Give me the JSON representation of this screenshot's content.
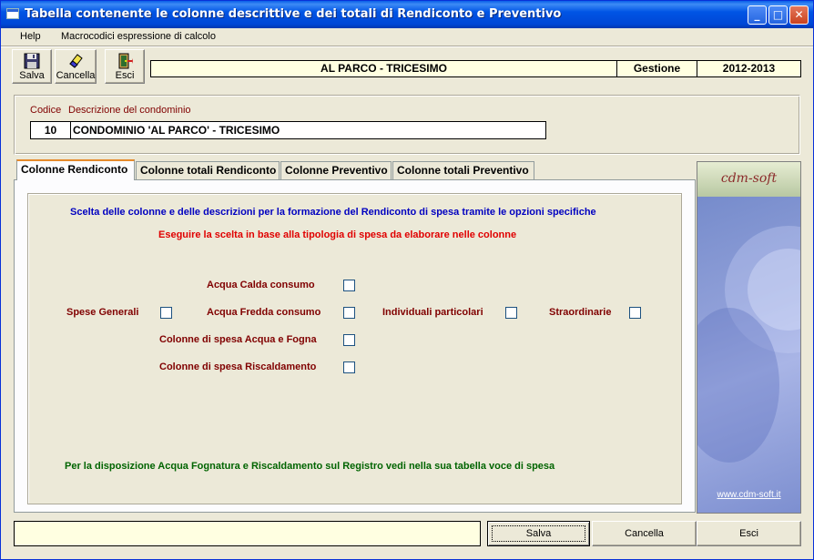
{
  "window": {
    "title": "Tabella contenente le colonne descrittive e dei totali di Rendiconto e Preventivo",
    "minimize_glyph": "_",
    "maximize_glyph": "□",
    "close_glyph": "✕"
  },
  "menubar": {
    "items": [
      "Help",
      "Macrocodici espressione di calcolo"
    ]
  },
  "toolbar": {
    "save_label": "Salva",
    "delete_label": "Cancella",
    "exit_label": "Esci",
    "condominium_name": "AL PARCO - TRICESIMO",
    "management_label": "Gestione",
    "management_period": "2012-2013"
  },
  "condominium": {
    "code_label": "Codice",
    "description_label": "Descrizione del condominio",
    "code_value": "10",
    "description_value": "CONDOMINIO 'AL PARCO' - TRICESIMO"
  },
  "tabs": [
    {
      "label": "Colonne Rendiconto",
      "active": true
    },
    {
      "label": "Colonne totali Rendiconto",
      "active": false
    },
    {
      "label": "Colonne Preventivo",
      "active": false
    },
    {
      "label": "Colonne totali Preventivo",
      "active": false
    }
  ],
  "content": {
    "heading": "Scelta delle colonne e delle descrizioni per la formazione del Rendiconto di spesa tramite le opzioni specifiche",
    "subheading": "Eseguire la scelta in base alla tipologia di spesa da elaborare nelle colonne",
    "options": {
      "acqua_calda": "Acqua Calda consumo",
      "spese_generali": "Spese Generali",
      "acqua_fredda": "Acqua Fredda consumo",
      "individuali": "Individuali particolari",
      "straordinarie": "Straordinarie",
      "acqua_fogna": "Colonne di spesa Acqua e Fogna",
      "riscaldamento": "Colonne di spesa Riscaldamento"
    },
    "note": "Per la disposizione Acqua Fognatura e Riscaldamento sul Registro vedi nella sua tabella voce di spesa"
  },
  "brand": {
    "logo": "cdm-soft",
    "url": "www.cdm-soft.it"
  },
  "bottom": {
    "status_text": "",
    "save_label": "Salva",
    "delete_label": "Cancella",
    "exit_label": "Esci"
  },
  "colors": {
    "title_blue": "#0055E5",
    "heading_blue": "#0000C0",
    "subheading_red": "#E00000",
    "option_maroon": "#800000",
    "note_green": "#006400",
    "info_yellow": "#FFFFE1"
  }
}
